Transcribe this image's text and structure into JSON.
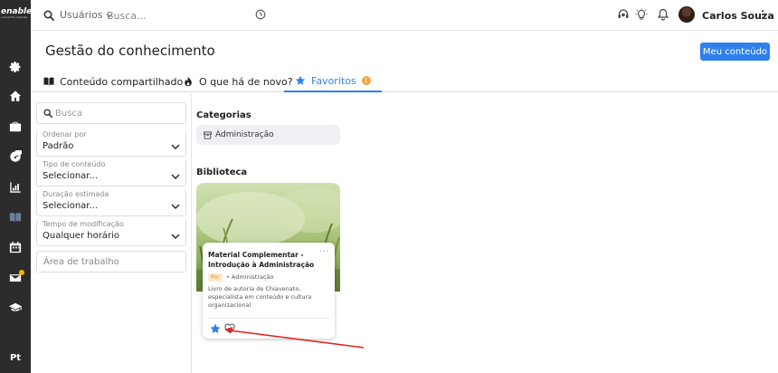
{
  "brand": {
    "logo": "enable/",
    "logo_sub": "connect to educate"
  },
  "sidebar": {
    "items": [
      {
        "icon": "gear-icon"
      },
      {
        "icon": "home-icon"
      },
      {
        "icon": "briefcase-icon"
      },
      {
        "icon": "dashboard-icon"
      },
      {
        "icon": "chart-icon"
      },
      {
        "icon": "book-icon",
        "active": true
      },
      {
        "icon": "calendar-icon"
      },
      {
        "icon": "mail-icon",
        "notification": true
      },
      {
        "icon": "graduation-cap-icon"
      }
    ],
    "language": "Pt"
  },
  "topbar": {
    "scope": "Usuários",
    "search_placeholder": "Busca...",
    "user_name": "Carlos Souza"
  },
  "header": {
    "title": "Gestão do conhecimento",
    "primary_button": "Meu conteúdo"
  },
  "tabs": [
    {
      "label": "Conteúdo compartilhado",
      "icon": "book-open-icon"
    },
    {
      "label": "O que há de novo?",
      "icon": "fire-icon"
    },
    {
      "label": "Favoritos",
      "icon": "star-icon",
      "active": true,
      "badge": "1"
    }
  ],
  "filters": {
    "search_placeholder": "Busca",
    "selects": [
      {
        "label": "Ordenar por",
        "value": "Padrão"
      },
      {
        "label": "Tipo de conteúdo",
        "value": "Selecionar..."
      },
      {
        "label": "Duração estimada",
        "value": "Selecionar..."
      },
      {
        "label": "Tempo de modificação",
        "value": "Qualquer horário"
      }
    ],
    "workspace_placeholder": "Área de trabalho"
  },
  "main": {
    "categories_title": "Categorias",
    "category_chip": "Administração",
    "library_title": "Biblioteca",
    "card": {
      "title": "Material Complementar - Introdução à Administração",
      "more": "···",
      "language_tag": "Por",
      "category": "• Administração",
      "description": "Livro de autoria de Chiavenato, especialista em conteúdo e cultura organizacional"
    }
  },
  "colors": {
    "accent": "#2f80ed",
    "sidebar_bg": "#2c2c2c",
    "badge": "#f0a43a",
    "annotation_arrow": "#e02020"
  }
}
